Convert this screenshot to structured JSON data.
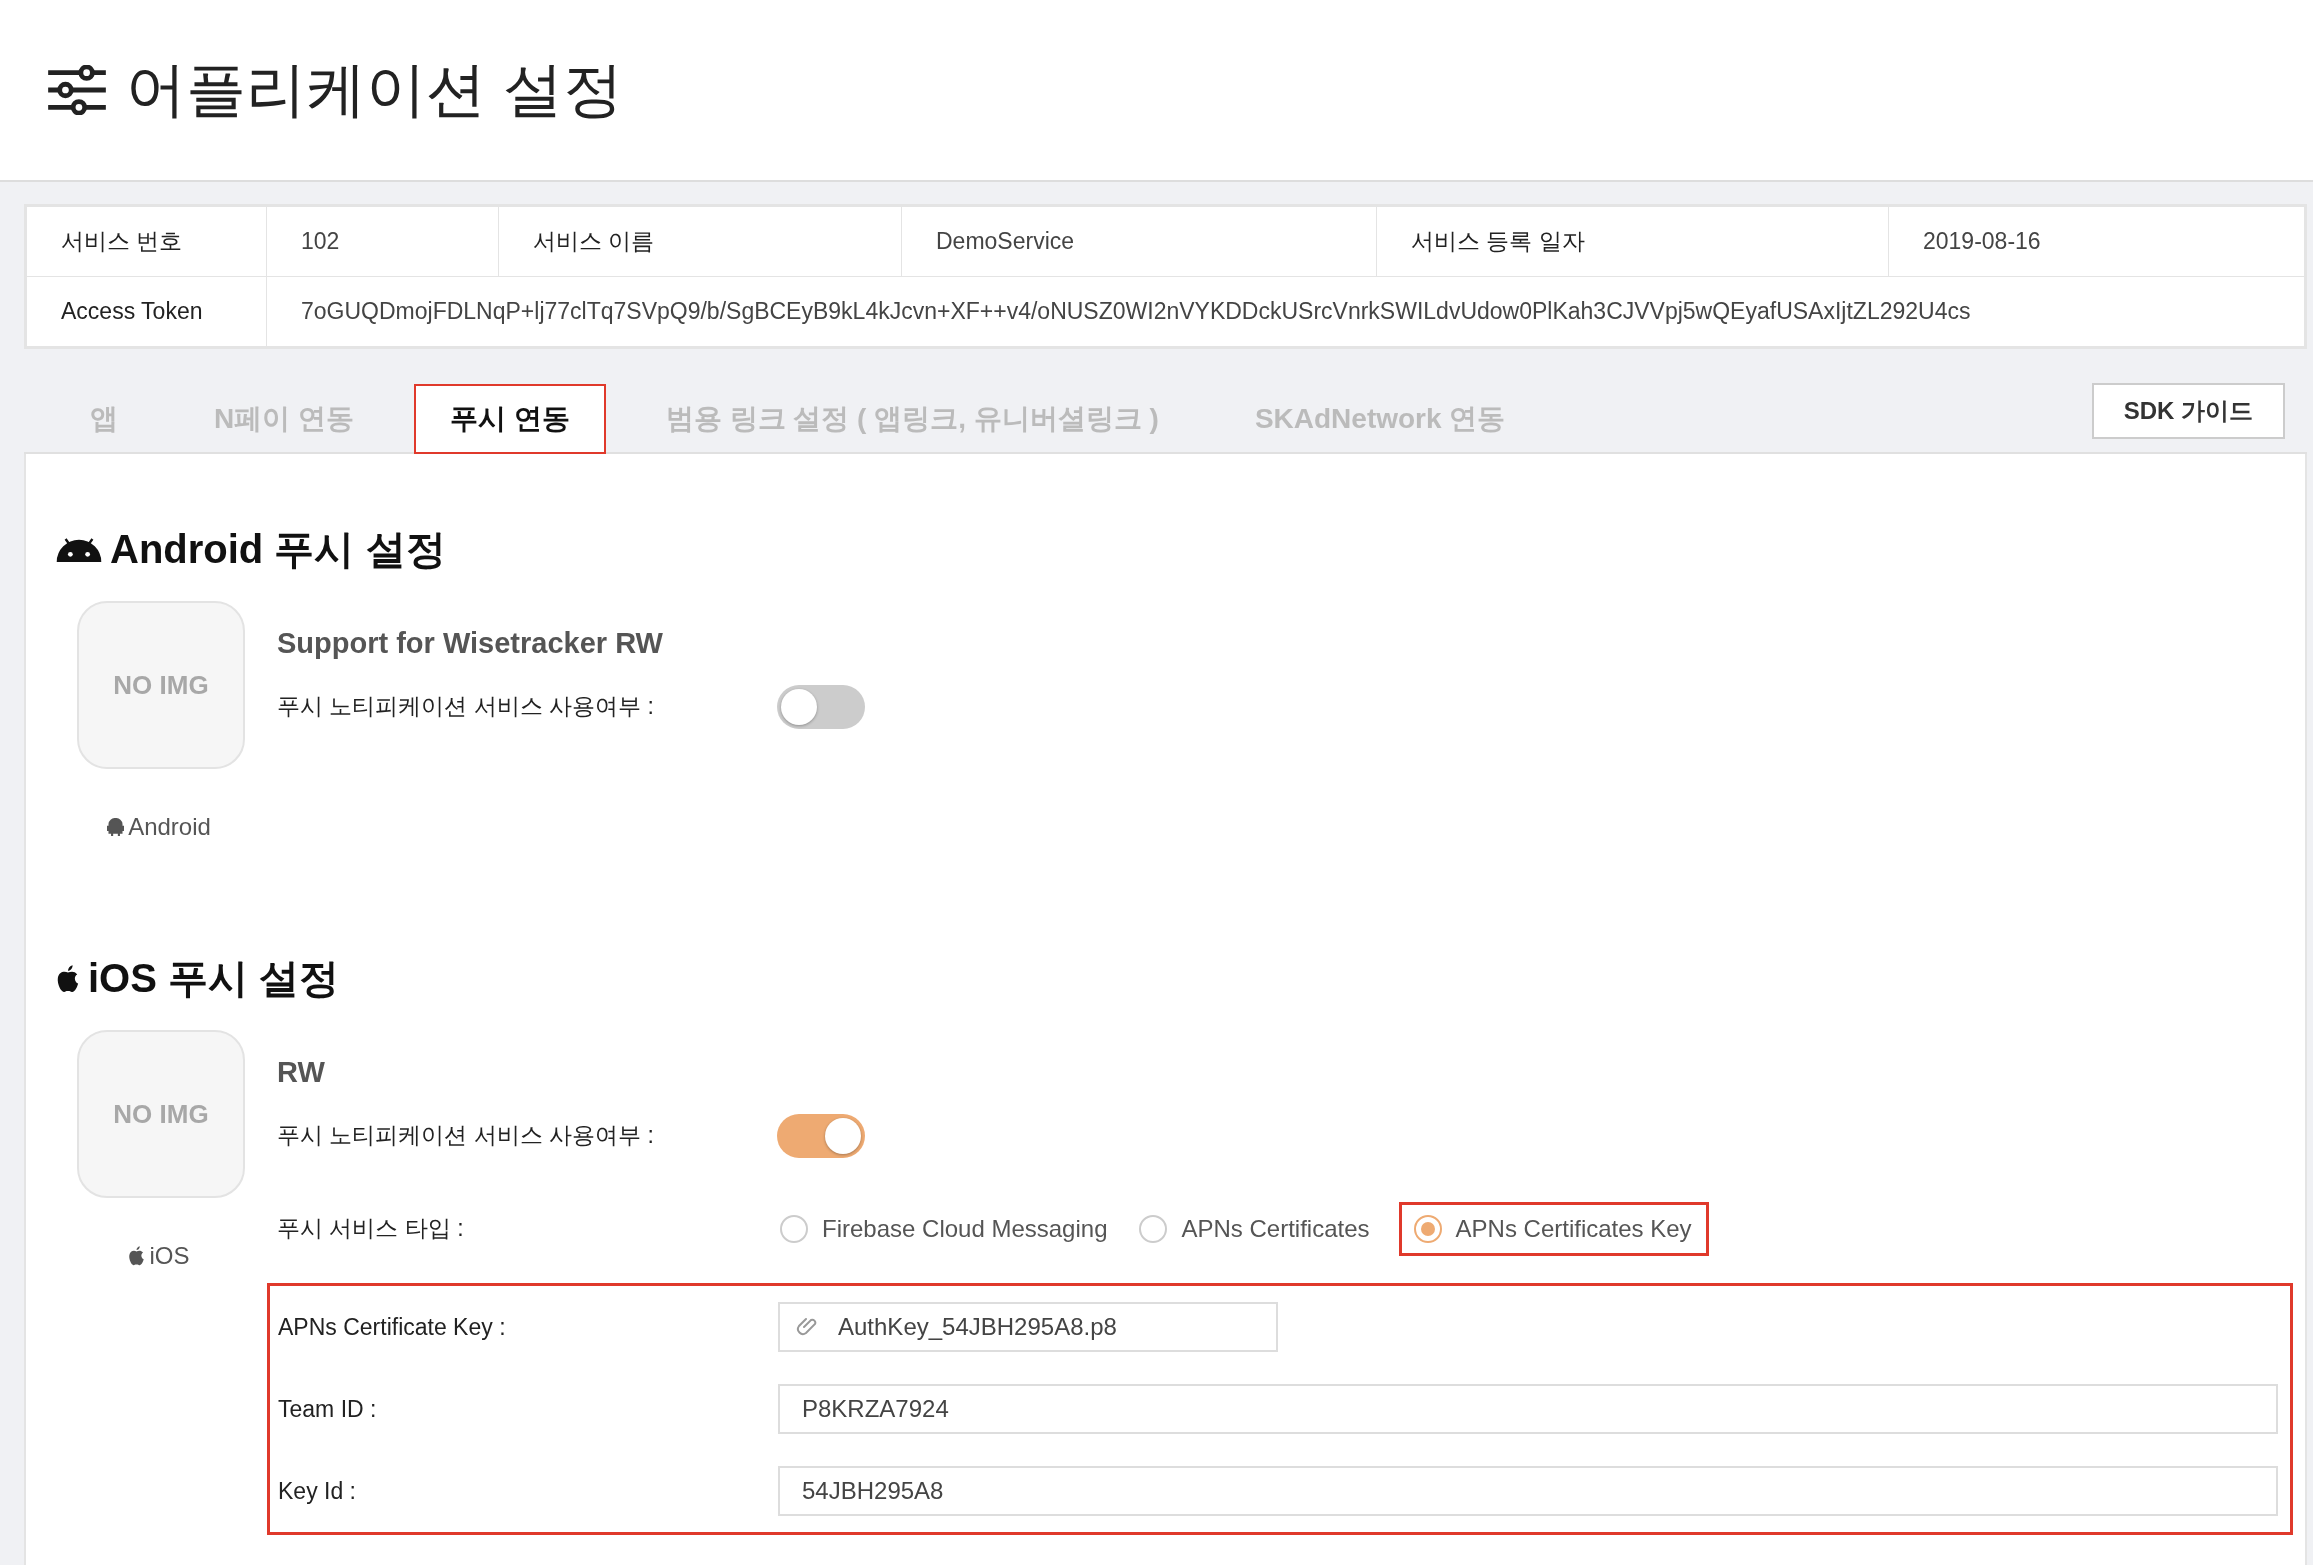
{
  "page": {
    "title": "어플리케이션 설정"
  },
  "info_table": {
    "rows": [
      {
        "cells": [
          {
            "kind": "label",
            "text": "서비스 번호"
          },
          {
            "kind": "value",
            "text": "102"
          },
          {
            "kind": "label",
            "text": "서비스 이름"
          },
          {
            "kind": "value",
            "text": "DemoService"
          },
          {
            "kind": "label",
            "text": "서비스 등록 일자"
          },
          {
            "kind": "value",
            "text": "2019-08-16"
          }
        ]
      },
      {
        "cells": [
          {
            "kind": "label",
            "text": "Access Token"
          },
          {
            "kind": "value",
            "text": "7oGUQDmojFDLNqP+lj77clTq7SVpQ9/b/SgBCEyB9kL4kJcvn+XF++v4/oNUSZ0WI2nVYKDDckUSrcVnrkSWILdvUdow0PlKah3CJVVpj5wQEyafUSAxIjtZL292U4cs"
          }
        ]
      }
    ]
  },
  "tabs": [
    {
      "label": "앱",
      "selected": false
    },
    {
      "label": "N페이 연동",
      "selected": false
    },
    {
      "label": "푸시 연동",
      "selected": true
    },
    {
      "label": "범용 링크 설정 ( 앱링크, 유니버셜링크 )",
      "selected": false
    },
    {
      "label": "SKAdNetwork 연동",
      "selected": false
    }
  ],
  "sdk_button": "SDK 가이드",
  "sections": [
    {
      "kind": "android",
      "title": "Android 푸시 설정",
      "image_placeholder": "NO IMG",
      "platform_label": "Android",
      "app_name": "Support for Wisetracker RW",
      "fields": [
        {
          "kind": "toggle",
          "label": "푸시 노티피케이션 서비스 사용여부 :",
          "on": false
        }
      ]
    },
    {
      "kind": "ios",
      "title": "iOS 푸시 설정",
      "image_placeholder": "NO IMG",
      "platform_label": "iOS",
      "app_name": "RW",
      "fields": [
        {
          "kind": "toggle",
          "label": "푸시 노티피케이션 서비스 사용여부 :",
          "on": true
        },
        {
          "kind": "radio",
          "label": "푸시 서비스 타입 :",
          "options": [
            {
              "label": "Firebase Cloud Messaging",
              "selected": false
            },
            {
              "label": "APNs Certificates",
              "selected": false
            },
            {
              "label": "APNs Certificates Key",
              "selected": true
            }
          ]
        }
      ],
      "key_settings": {
        "highlighted": true,
        "fields": [
          {
            "kind": "file",
            "label": "APNs Certificate Key :",
            "value": "AuthKey_54JBH295A8.p8"
          },
          {
            "kind": "text",
            "label": "Team ID :",
            "value": "P8KRZA7924"
          },
          {
            "kind": "text",
            "label": "Key Id :",
            "value": "54JBH295A8"
          }
        ]
      }
    }
  ]
}
